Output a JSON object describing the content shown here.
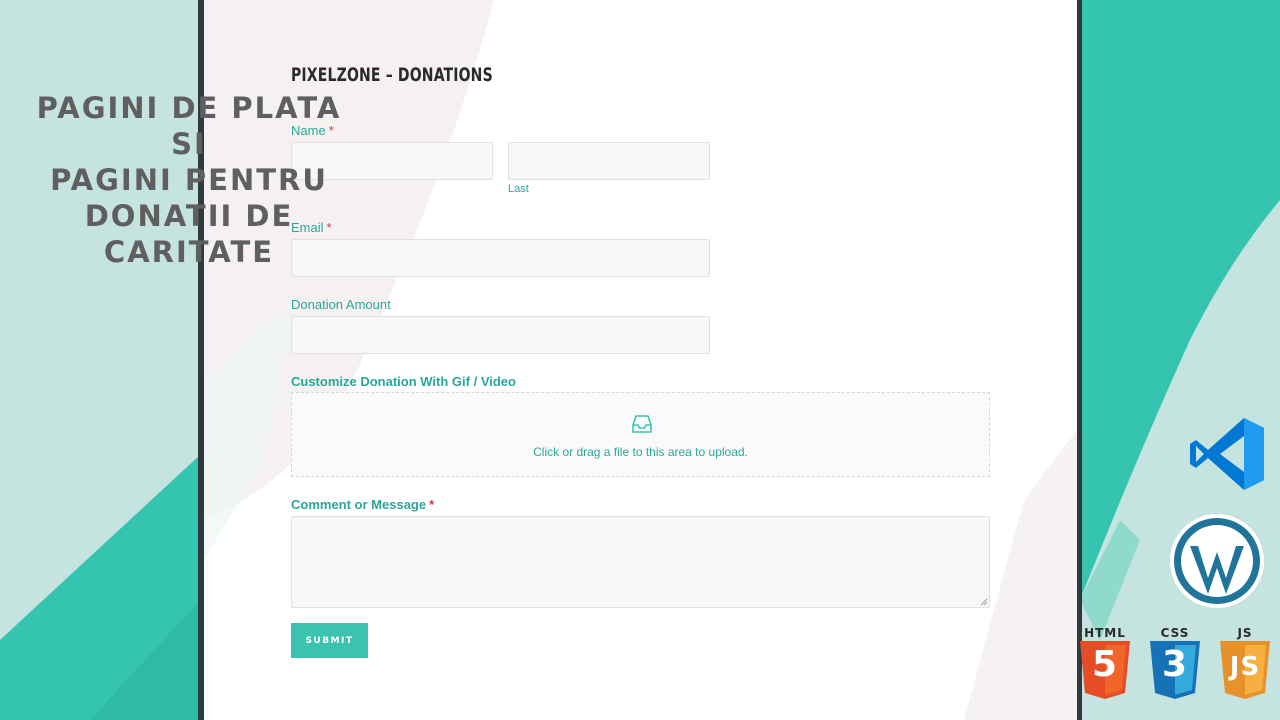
{
  "promo": {
    "lines": [
      "PAGINI DE PLATA",
      "SI",
      "PAGINI PENTRU",
      "DONATII DE",
      "CARITATE"
    ]
  },
  "form": {
    "title": "PIXELZONE – DONATIONS",
    "name_label": "Name",
    "required_mark": "*",
    "last_sublabel": "Last",
    "email_label": "Email",
    "donation_label": "Donation Amount",
    "customize_label": "Customize Donation With Gif / Video",
    "upload_text": "Click or drag a file to this area to upload.",
    "comment_label": "Comment or Message",
    "submit_label": "SUBMIT"
  },
  "badges": {
    "html": "HTML",
    "html_num": "5",
    "css": "CSS",
    "css_num": "3",
    "js": "JS",
    "js_mark": "JS"
  },
  "icons": [
    "inbox-upload-icon",
    "vscode-logo-icon",
    "wordpress-logo-icon",
    "html5-icon",
    "css3-icon",
    "js-icon",
    "resize-handle-icon"
  ],
  "colors": {
    "accent": "#3cc3af",
    "label": "#2ba69a",
    "required": "#d43b3b",
    "teal_splash": "#35c4b0",
    "html5": "#e44d26",
    "css3": "#1572b6",
    "js": "#f0a030",
    "wordpress": "#21759b",
    "vscode": "#0078d4"
  }
}
